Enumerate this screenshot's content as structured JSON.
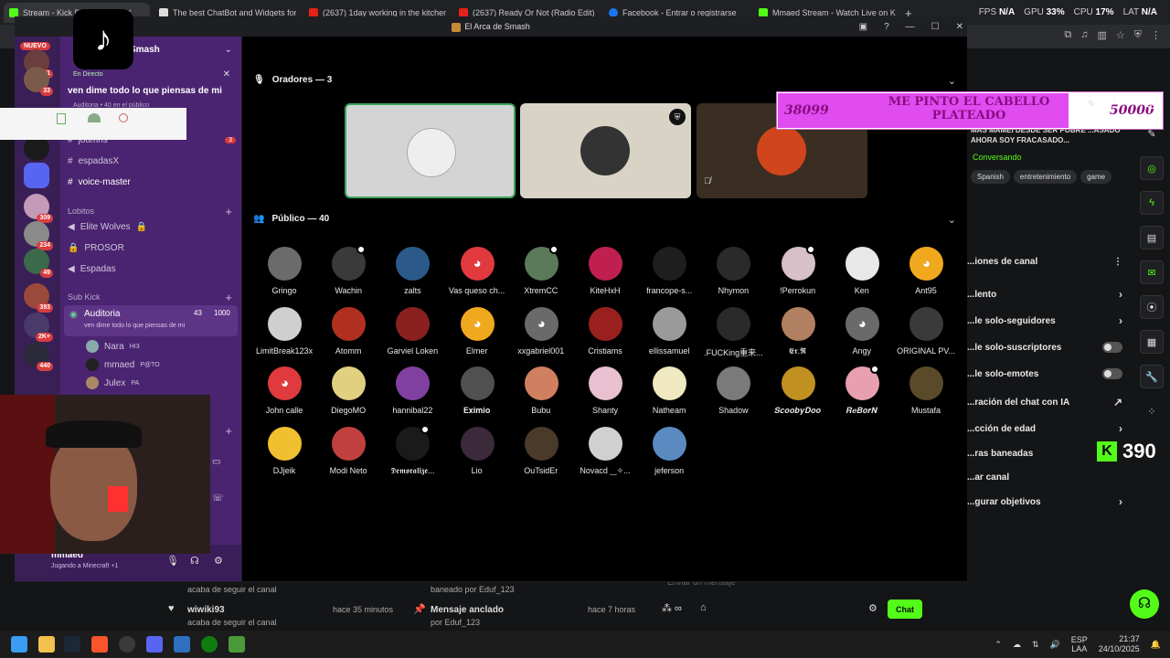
{
  "browser": {
    "tabs": [
      {
        "title": "Stream - Kick Dashboard",
        "active": true
      },
      {
        "title": "The best ChatBot and Widgets for Ki"
      },
      {
        "title": "(2637) 1day working in the kitchen"
      },
      {
        "title": "(2637) Ready Or Not (Radio Edit) - Yo"
      },
      {
        "title": "Facebook - Entrar o registrarse"
      },
      {
        "title": "Mmaed Stream - Watch Live on Kick"
      }
    ],
    "perf": {
      "fps_label": "FPS",
      "fps_value": "N/A",
      "gpu_label": "GPU",
      "gpu_value": "33%",
      "cpu_label": "CPU",
      "cpu_value": "17%",
      "lat_label": "LAT",
      "lat_value": "N/A"
    }
  },
  "discord": {
    "window_title": "El Arca de Smash",
    "server_name": "Smash",
    "live_badge": "En Directo",
    "live_title": "ven dime todo lo que piensas de mi",
    "live_sub": "Auditoria • 40 en el público",
    "nuevo_badge": "NUEVO",
    "rail_badges": [
      "361",
      "33",
      "309",
      "234",
      "49",
      "393",
      "2K+",
      "440"
    ],
    "channels": [
      {
        "name": "joumns",
        "badge": "3"
      },
      {
        "name": "espadasX"
      },
      {
        "name": "voice-master"
      }
    ],
    "category_lobitos": "Lobitos",
    "lobitos_channels": [
      "Elite Wolves",
      "PROSOR",
      "Espadas"
    ],
    "category_subkick": "Sub Kick",
    "stage_channel": {
      "name": "Auditoria",
      "count": "43",
      "cap": "1000",
      "topic": "ven dime todo lo que piensas de mi"
    },
    "stage_users": [
      {
        "name": "Nara",
        "tag": "HI3"
      },
      {
        "name": "mmaed",
        "tag": "P@TO"
      },
      {
        "name": "Julex",
        "tag": "PA"
      }
    ],
    "user_panel": {
      "name": "mmaed",
      "status": "Jugando a Minecraft +1"
    },
    "speakers_header": "Oradores — 3",
    "audience_header": "Público — 40",
    "members": [
      {
        "name": "Gringo",
        "color": "#6b6b6b"
      },
      {
        "name": "Wachin",
        "color": "#3a3a3a",
        "status": true
      },
      {
        "name": "zalts",
        "color": "#2b5a8a"
      },
      {
        "name": "Vas queso ch...",
        "color": "#e03a3e",
        "discord": true
      },
      {
        "name": "XtremCC",
        "color": "#5a7a5a",
        "status": true
      },
      {
        "name": "KiteHxH",
        "color": "#c02050"
      },
      {
        "name": "francope-s...",
        "color": "#1e1e1e"
      },
      {
        "name": "Nhymon",
        "color": "#2a2a2a"
      },
      {
        "name": "!Perrokun",
        "color": "#d8c0c8",
        "status": true
      },
      {
        "name": "Ken",
        "color": "#e8e8e8"
      },
      {
        "name": "Ant95",
        "color": "#f0a81e",
        "discord": true
      },
      {
        "name": "LimitBreak123x",
        "color": "#cfcfcf"
      },
      {
        "name": "Atomm",
        "color": "#b03020"
      },
      {
        "name": "Garviel Loken",
        "color": "#8a2020"
      },
      {
        "name": "Elmer",
        "color": "#f0a81e",
        "discord": true
      },
      {
        "name": "xxgabriel001",
        "color": "#6a6a6a",
        "discord": true
      },
      {
        "name": "Cristiams",
        "color": "#9a2020"
      },
      {
        "name": "ellissamuel",
        "color": "#9a9a9a"
      },
      {
        "name": ".FUCKing重来...",
        "color": "#2a2a2a"
      },
      {
        "name": "𝕰𝖗.𝕽",
        "color": "#b08060"
      },
      {
        "name": "Angy",
        "color": "#6a6a6a",
        "discord": true
      },
      {
        "name": "ORIGINAL PV...",
        "color": "#3a3a3a"
      },
      {
        "name": "John calle",
        "color": "#e03a3e",
        "discord": true
      },
      {
        "name": "DiegoMO",
        "color": "#e0d080"
      },
      {
        "name": "hannibal22",
        "color": "#8040a0"
      },
      {
        "name": "𝐄𝐱𝐢𝐦𝐢𝐨",
        "color": "#505050"
      },
      {
        "name": "Bubu",
        "color": "#d08060"
      },
      {
        "name": "Shanty",
        "color": "#e8c0d0"
      },
      {
        "name": "Natheam",
        "color": "#f0e8c0"
      },
      {
        "name": "Shadow",
        "color": "#7a7a7a"
      },
      {
        "name": "𝑺𝒄𝒐𝒐𝒃𝒚𝑫𝒐𝒐",
        "color": "#c09020"
      },
      {
        "name": "𝑹𝒆𝑩𝒐𝒓𝑵",
        "color": "#e8a0b0",
        "status": true
      },
      {
        "name": "Mustafa",
        "color": "#5a4a2a"
      },
      {
        "name": "DJjeik",
        "color": "#f0c030"
      },
      {
        "name": "Modi Neto",
        "color": "#c04040"
      },
      {
        "name": "𝕯𝖊𝖒𝖔𝖗𝖆𝖑𝖎𝖟𝖊...",
        "color": "#1a1a1a",
        "status": true
      },
      {
        "name": "Lio",
        "color": "#3a2a3a"
      },
      {
        "name": "OuTsidEr",
        "color": "#4a3a2a"
      },
      {
        "name": "Novacd ‿✧...",
        "color": "#d0d0d0"
      },
      {
        "name": "jeferson",
        "color": "#5a8ac0"
      }
    ]
  },
  "overlay": {
    "left_num": "38099",
    "message": "ME PINTO EL CABELLO PLATEADO",
    "right_num": "50000"
  },
  "kick": {
    "stream_title": "MAS MAMEI DESDE SER POBRE ...ASADO AHORA SOY FRACASADO...",
    "status": "Conversando",
    "tags": [
      "Spanish",
      "entretenimiento",
      "game"
    ],
    "settings_title": "...iones de canal",
    "settings": [
      {
        "label": "...lento",
        "kind": "chevron"
      },
      {
        "label": "...le solo-seguidores",
        "kind": "chevron"
      },
      {
        "label": "...le solo-suscriptores",
        "kind": "toggle"
      },
      {
        "label": "...le solo-emotes",
        "kind": "toggle"
      },
      {
        "label": "...ración del chat con IA",
        "kind": "external"
      },
      {
        "label": "...cción de edad",
        "kind": "chevron"
      },
      {
        "label": "...ras baneadas",
        "kind": "none"
      },
      {
        "label": "...ar canal",
        "kind": "none"
      },
      {
        "label": "...gurar objetivos",
        "kind": "chevron"
      }
    ],
    "viewer_count": "390",
    "chat_rows": [
      {
        "user": "",
        "text": "acaba de seguir el canal"
      },
      {
        "user": "wiwiki93",
        "text": "acaba de seguir el canal",
        "time": "hace 35 minutos"
      },
      {
        "user": "",
        "text": "baneado por Eduf_123"
      },
      {
        "user": "Mensaje anclado",
        "text": "por Eduf_123",
        "time": "hace 7 horas"
      }
    ],
    "chat_placeholder": "Enviar un mensaje",
    "chat_button": "Chat"
  },
  "taskbar": {
    "lang": "ESP",
    "lang2": "LAA",
    "time": "21:37",
    "date": "24/10/2025"
  }
}
